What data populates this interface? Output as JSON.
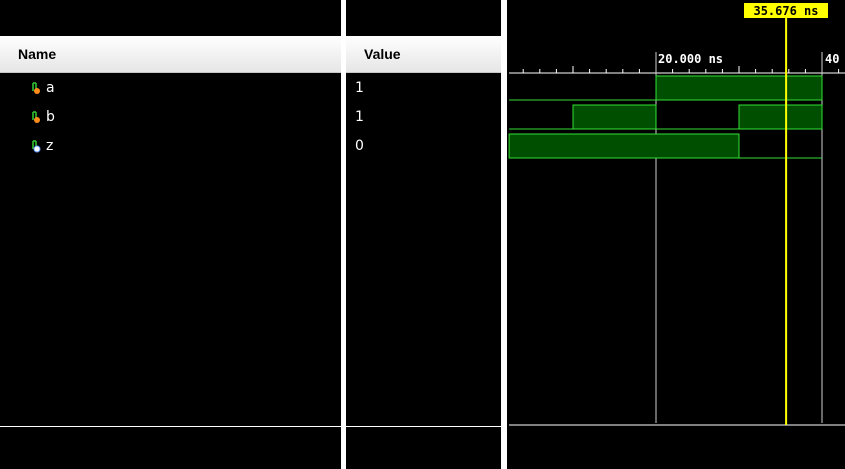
{
  "name_panel": {
    "header": "Name",
    "signals": [
      {
        "name": "a",
        "icon": "input-signal-icon"
      },
      {
        "name": "b",
        "icon": "input-signal-icon"
      },
      {
        "name": "z",
        "icon": "output-signal-icon"
      }
    ]
  },
  "value_panel": {
    "header": "Value",
    "values": [
      "1",
      "1",
      "0"
    ]
  },
  "wave_panel": {
    "cursor_label": "35.676 ns",
    "ruler_labels": [
      "20.000 ns",
      "40"
    ],
    "colors": {
      "wave_fill": "#004f00",
      "wave_line": "#33e033",
      "cursor": "#ffff00",
      "cursor_label_bg": "#ffff00"
    },
    "timescale_ns": {
      "start": 2.3,
      "end": 40,
      "cursor": 35.676
    },
    "waves": [
      {
        "signal": "a",
        "segments": [
          [
            2.3,
            20,
            0
          ],
          [
            20,
            40,
            1
          ]
        ]
      },
      {
        "signal": "b",
        "segments": [
          [
            2.3,
            10,
            0
          ],
          [
            10,
            20,
            1
          ],
          [
            20,
            30,
            0
          ],
          [
            30,
            40,
            1
          ]
        ]
      },
      {
        "signal": "z",
        "segments": [
          [
            2.3,
            30,
            1
          ],
          [
            30,
            40,
            0
          ]
        ]
      }
    ]
  }
}
